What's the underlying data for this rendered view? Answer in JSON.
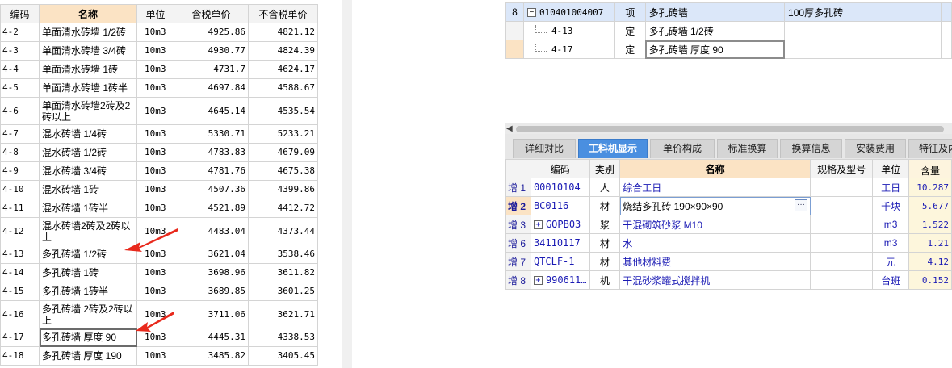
{
  "left_table": {
    "headers": [
      "编码",
      "名称",
      "单位",
      "含税单价",
      "不含税单价"
    ],
    "rows": [
      {
        "code": "4-2",
        "name": "单面清水砖墙 1/2砖",
        "unit": "10m3",
        "price_tax": "4925.86",
        "price_notax": "4821.12"
      },
      {
        "code": "4-3",
        "name": "单面清水砖墙 3/4砖",
        "unit": "10m3",
        "price_tax": "4930.77",
        "price_notax": "4824.39"
      },
      {
        "code": "4-4",
        "name": "单面清水砖墙 1砖",
        "unit": "10m3",
        "price_tax": "4731.7",
        "price_notax": "4624.17"
      },
      {
        "code": "4-5",
        "name": "单面清水砖墙 1砖半",
        "unit": "10m3",
        "price_tax": "4697.84",
        "price_notax": "4588.67"
      },
      {
        "code": "4-6",
        "name": "单面清水砖墙2砖及2砖以上",
        "unit": "10m3",
        "price_tax": "4645.14",
        "price_notax": "4535.54"
      },
      {
        "code": "4-7",
        "name": "混水砖墙 1/4砖",
        "unit": "10m3",
        "price_tax": "5330.71",
        "price_notax": "5233.21"
      },
      {
        "code": "4-8",
        "name": "混水砖墙 1/2砖",
        "unit": "10m3",
        "price_tax": "4783.83",
        "price_notax": "4679.09"
      },
      {
        "code": "4-9",
        "name": "混水砖墙 3/4砖",
        "unit": "10m3",
        "price_tax": "4781.76",
        "price_notax": "4675.38"
      },
      {
        "code": "4-10",
        "name": "混水砖墙 1砖",
        "unit": "10m3",
        "price_tax": "4507.36",
        "price_notax": "4399.86"
      },
      {
        "code": "4-11",
        "name": "混水砖墙 1砖半",
        "unit": "10m3",
        "price_tax": "4521.89",
        "price_notax": "4412.72"
      },
      {
        "code": "4-12",
        "name": "混水砖墙2砖及2砖以上",
        "unit": "10m3",
        "price_tax": "4483.04",
        "price_notax": "4373.44"
      },
      {
        "code": "4-13",
        "name": "多孔砖墙 1/2砖",
        "unit": "10m3",
        "price_tax": "3621.04",
        "price_notax": "3538.46"
      },
      {
        "code": "4-14",
        "name": "多孔砖墙 1砖",
        "unit": "10m3",
        "price_tax": "3698.96",
        "price_notax": "3611.82"
      },
      {
        "code": "4-15",
        "name": "多孔砖墙 1砖半",
        "unit": "10m3",
        "price_tax": "3689.85",
        "price_notax": "3601.25"
      },
      {
        "code": "4-16",
        "name": "多孔砖墙 2砖及2砖以上",
        "unit": "10m3",
        "price_tax": "3711.06",
        "price_notax": "3621.71"
      },
      {
        "code": "4-17",
        "name": "多孔砖墙 厚度 90",
        "unit": "10m3",
        "price_tax": "4445.31",
        "price_notax": "4338.53"
      },
      {
        "code": "4-18",
        "name": "多孔砖墙 厚度 190",
        "unit": "10m3",
        "price_tax": "3485.82",
        "price_notax": "3405.45"
      }
    ]
  },
  "top_table": {
    "rows": [
      {
        "num": "8",
        "code": "010401004007",
        "type": "项",
        "name": "多孔砖墙",
        "spec": "100厚多孔砖"
      },
      {
        "num": "",
        "code": "4-13",
        "type": "定",
        "name": "多孔砖墙 1/2砖",
        "spec": ""
      },
      {
        "num": "",
        "code": "4-17",
        "type": "定",
        "name": "多孔砖墙 厚度 90",
        "spec": ""
      }
    ]
  },
  "tabs": [
    "详细对比",
    "工料机显示",
    "单价构成",
    "标准换算",
    "换算信息",
    "安装费用",
    "特征及内"
  ],
  "bottom_table": {
    "headers": [
      "编码",
      "类别",
      "名称",
      "规格及型号",
      "单位",
      "含量"
    ],
    "rows": [
      {
        "rowhdr": "增 1",
        "code": "00010104",
        "cat": "人",
        "name": "综合工日",
        "spec": "",
        "unit": "工日",
        "qty": "10.287"
      },
      {
        "rowhdr": "增 2",
        "code": "BC0116",
        "cat": "材",
        "name": "烧结多孔砖 190×90×90",
        "spec": "",
        "unit": "千块",
        "qty": "5.677"
      },
      {
        "rowhdr": "增 3",
        "code": "GQPB03",
        "cat": "浆",
        "name": "干混砌筑砂浆 M10",
        "spec": "",
        "unit": "m3",
        "qty": "1.522"
      },
      {
        "rowhdr": "增 6",
        "code": "34110117",
        "cat": "材",
        "name": "水",
        "spec": "",
        "unit": "m3",
        "qty": "1.21"
      },
      {
        "rowhdr": "增 7",
        "code": "QTCLF-1",
        "cat": "材",
        "name": "其他材料费",
        "spec": "",
        "unit": "元",
        "qty": "4.12"
      },
      {
        "rowhdr": "增 8",
        "code": "990611…",
        "cat": "机",
        "name": "干混砂浆罐式搅拌机",
        "spec": "",
        "unit": "台班",
        "qty": "0.152"
      }
    ],
    "expand_symbol": "+",
    "ellipsis": "···"
  },
  "colors": {
    "tab_active": "#4a8fe0",
    "header_selected": "#fbe3c4",
    "arrow_red": "#e8291c",
    "text_blue": "#1a1ab4"
  }
}
